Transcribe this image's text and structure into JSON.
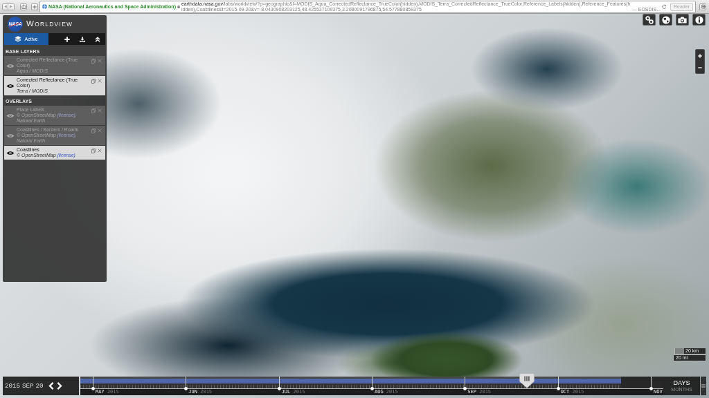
{
  "browser": {
    "site_identity": "NASA (National Aeronautics and Space Administration)",
    "url_host": "earthdata.nasa.gov",
    "url_path": "/labs/worldview/?p=geographic&l=MODIS_Aqua_CorrectedReflectance_TrueColor(hidden),MODIS_Terra_CorrectedReflectance_TrueColor,Reference_Labels(hidden),Reference_Features(hidden),Coastlines&t=2015-09-20&v=-8.0430908203125,48.425537109375,3.2080091796875,54.577880859375",
    "page_title": "— EOSDIS...",
    "reader": {
      "label": "Reader",
      "disabled": true
    }
  },
  "sidebar": {
    "logo": "NASA",
    "title": "WORLDVIEW",
    "tabs": [
      {
        "label": "Active",
        "selected": true
      }
    ],
    "sections": [
      {
        "title": "BASE LAYERS",
        "layers": [
          {
            "name": "Corrected Reflectance (True Color)",
            "credit": [
              {
                "kind": "text",
                "text": "Aqua / MODIS"
              }
            ],
            "visible": false
          },
          {
            "name": "Corrected Reflectance (True Color)",
            "credit": [
              {
                "kind": "text",
                "text": "Terra / MODIS"
              }
            ],
            "visible": true
          }
        ]
      },
      {
        "title": "OVERLAYS",
        "layers": [
          {
            "name": "Place Labels",
            "credit": [
              {
                "kind": "text",
                "text": "© OpenStreetMap "
              },
              {
                "kind": "link",
                "text": "(license)"
              },
              {
                "kind": "text",
                "text": ", Natural Earth"
              }
            ],
            "visible": false
          },
          {
            "name": "Coastlines / Borders / Roads",
            "credit": [
              {
                "kind": "text",
                "text": "© OpenStreetMap "
              },
              {
                "kind": "link",
                "text": "(license)"
              },
              {
                "kind": "text",
                "text": ", Natural Earth"
              }
            ],
            "visible": false
          },
          {
            "name": "Coastlines",
            "credit": [
              {
                "kind": "text",
                "text": "© OpenStreetMap "
              },
              {
                "kind": "link",
                "text": "(license)"
              }
            ],
            "visible": true
          }
        ]
      }
    ]
  },
  "scale": {
    "km": "20 km",
    "mi": "20 mi"
  },
  "timeline": {
    "date": {
      "year": "2015",
      "month": "SEP",
      "day": "20"
    },
    "coverage": {
      "level": 0.928
    },
    "handle": {
      "level": 0.766
    },
    "months": [
      {
        "label": "MAY",
        "year": "2015"
      },
      {
        "label": "JUN",
        "year": "2015"
      },
      {
        "label": "JUL",
        "year": "2015"
      },
      {
        "label": "AUG",
        "year": "2015"
      },
      {
        "label": "SEP",
        "year": "2015"
      },
      {
        "label": "OCT",
        "year": "2015"
      },
      {
        "label": "NOV"
      }
    ],
    "zoom_levels": [
      {
        "label": "DAYS",
        "selected": true
      },
      {
        "label": "MONTHS",
        "selected": false
      }
    ]
  }
}
